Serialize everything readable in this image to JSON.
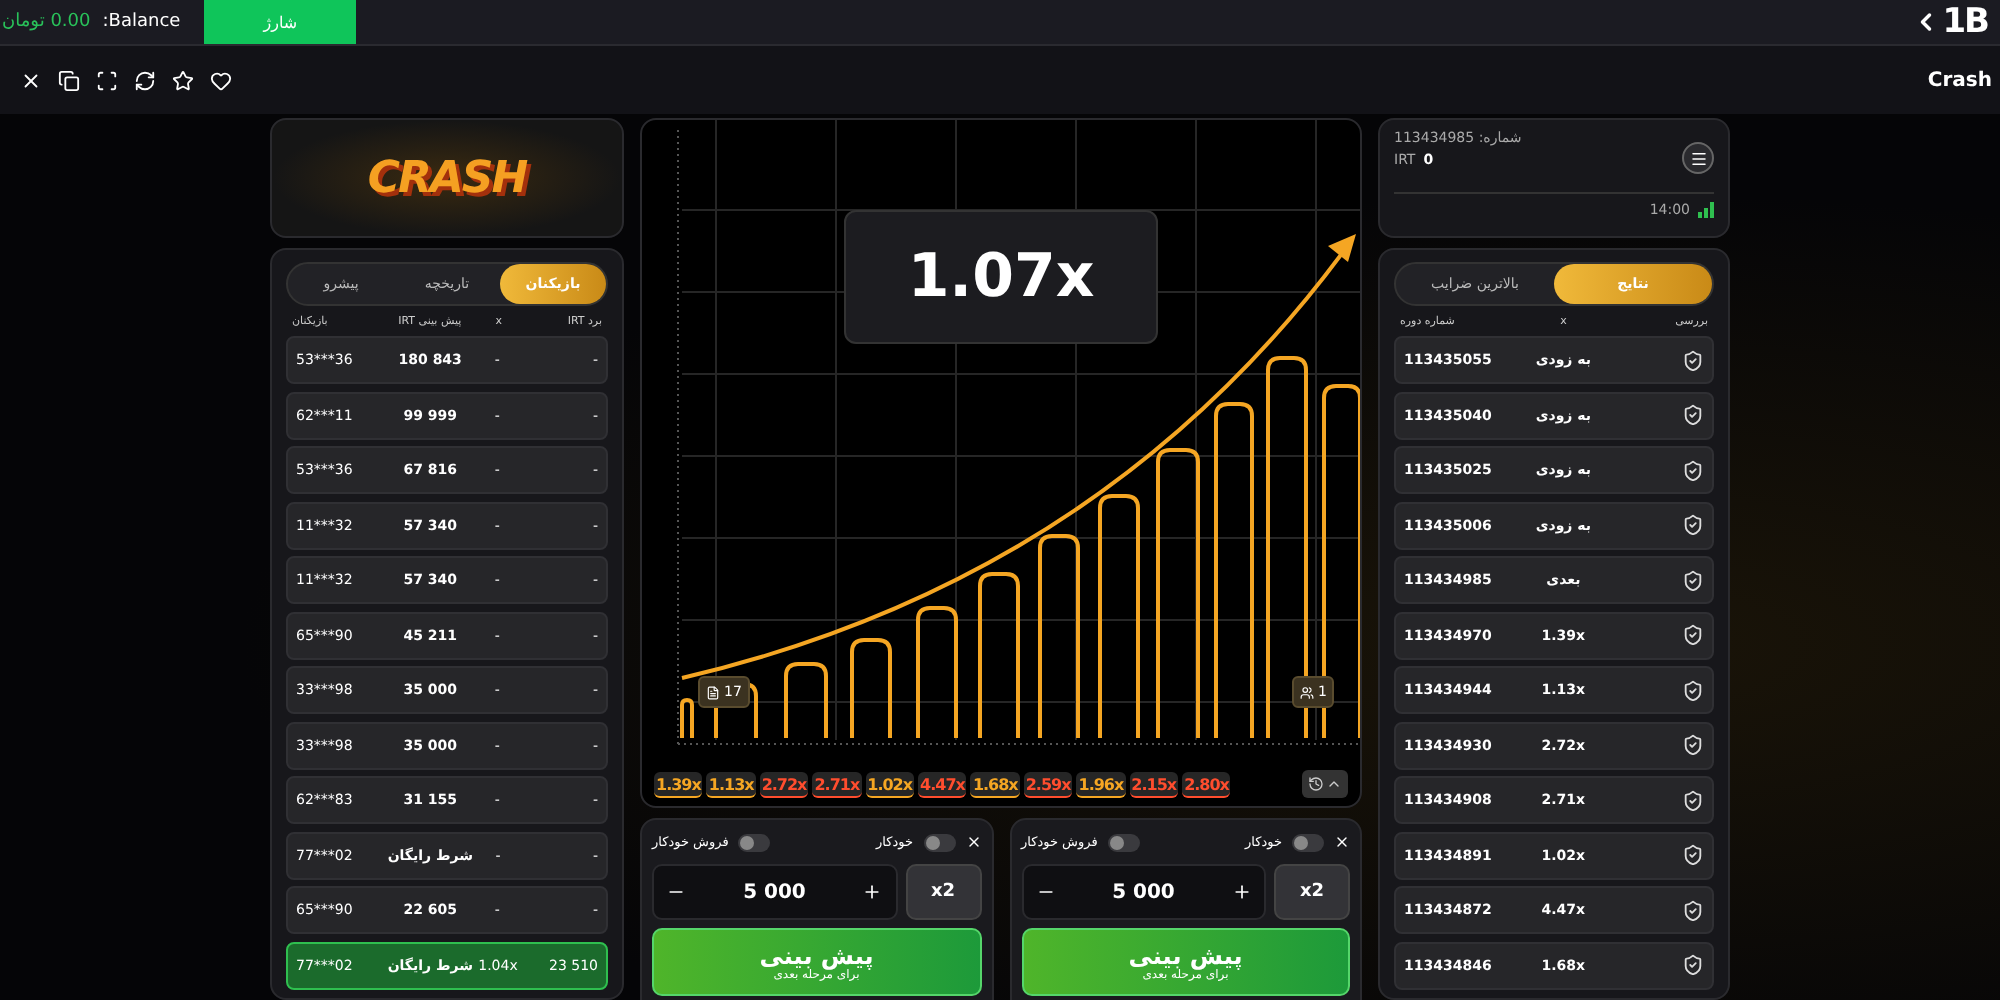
{
  "topbar": {
    "balance_label": "Balance:",
    "balance_value": "0.00 تومان",
    "deposit_button": "شارژ",
    "logo": "1B"
  },
  "toolbar": {
    "title": "Crash"
  },
  "game_logo": "CRASH",
  "players_panel": {
    "tabs": [
      {
        "label": "بازیکنان",
        "selected": true
      },
      {
        "label": "تاریخچه",
        "selected": false
      },
      {
        "label": "پیشرو",
        "selected": false
      }
    ],
    "columns": [
      "برد IRT",
      "x",
      "پیش بینی IRT",
      "بازیکنان"
    ],
    "rows": [
      {
        "player": "53***36",
        "bet": "180 843",
        "multiplier": "-",
        "win": "-",
        "won": false
      },
      {
        "player": "62***11",
        "bet": "99 999",
        "multiplier": "-",
        "win": "-",
        "won": false
      },
      {
        "player": "53***36",
        "bet": "67 816",
        "multiplier": "-",
        "win": "-",
        "won": false
      },
      {
        "player": "11***32",
        "bet": "57 340",
        "multiplier": "-",
        "win": "-",
        "won": false
      },
      {
        "player": "11***32",
        "bet": "57 340",
        "multiplier": "-",
        "win": "-",
        "won": false
      },
      {
        "player": "65***90",
        "bet": "45 211",
        "multiplier": "-",
        "win": "-",
        "won": false
      },
      {
        "player": "33***98",
        "bet": "35 000",
        "multiplier": "-",
        "win": "-",
        "won": false
      },
      {
        "player": "33***98",
        "bet": "35 000",
        "multiplier": "-",
        "win": "-",
        "won": false
      },
      {
        "player": "62***83",
        "bet": "31 155",
        "multiplier": "-",
        "win": "-",
        "won": false
      },
      {
        "player": "77***02",
        "bet": "شرط رایگان",
        "multiplier": "-",
        "win": "-",
        "won": false
      },
      {
        "player": "65***90",
        "bet": "22 605",
        "multiplier": "-",
        "win": "-",
        "won": false
      },
      {
        "player": "77***02",
        "bet": "شرط رایگان",
        "multiplier": "1.04x",
        "win": "23 510",
        "won": true
      }
    ]
  },
  "game": {
    "multiplier": "1.07x",
    "left_badge": "17",
    "right_badge": "1",
    "history": [
      {
        "value": "2.80x",
        "color": "#ff4d2e"
      },
      {
        "value": "2.15x",
        "color": "#ff4d2e"
      },
      {
        "value": "1.96x",
        "color": "#f5a623"
      },
      {
        "value": "2.59x",
        "color": "#ff4d2e"
      },
      {
        "value": "1.68x",
        "color": "#f5a623"
      },
      {
        "value": "4.47x",
        "color": "#ff4d2e"
      },
      {
        "value": "1.02x",
        "color": "#f5a623"
      },
      {
        "value": "2.71x",
        "color": "#ff4d2e"
      },
      {
        "value": "2.72x",
        "color": "#ff4d2e"
      },
      {
        "value": "1.13x",
        "color": "#f5a623"
      },
      {
        "value": "1.39x",
        "color": "#f5a623"
      }
    ]
  },
  "bets": [
    {
      "auto_cashout_label": "فروش خودکار",
      "auto_cashout_on": false,
      "auto_label": "خودکار",
      "auto_on": false,
      "amount": "5 000",
      "double_button": "x2",
      "action_title": "پیش بینی",
      "action_subtitle": "برای مرحله بعدی"
    },
    {
      "auto_cashout_label": "فروش خودکار",
      "auto_cashout_on": false,
      "auto_label": "خودکار",
      "auto_on": false,
      "amount": "5 000",
      "double_button": "x2",
      "action_title": "پیش بینی",
      "action_subtitle": "برای مرحله بعدی"
    }
  ],
  "account": {
    "round_label": "شماره: 113434985",
    "currency": "IRT",
    "balance": "0",
    "time": "14:00"
  },
  "results_panel": {
    "tabs": [
      {
        "label": "نتایج",
        "selected": true
      },
      {
        "label": "بالاترین ضرایب",
        "selected": false
      }
    ],
    "columns": [
      "بررسی",
      "x",
      "شماره دوره"
    ],
    "rows": [
      {
        "round": "113435055",
        "result": "به زودی"
      },
      {
        "round": "113435040",
        "result": "به زودی"
      },
      {
        "round": "113435025",
        "result": "به زودی"
      },
      {
        "round": "113435006",
        "result": "به زودی"
      },
      {
        "round": "113434985",
        "result": "بعدی"
      },
      {
        "round": "113434970",
        "result": "1.39x"
      },
      {
        "round": "113434944",
        "result": "1.13x"
      },
      {
        "round": "113434930",
        "result": "2.72x"
      },
      {
        "round": "113434908",
        "result": "2.71x"
      },
      {
        "round": "113434891",
        "result": "1.02x"
      },
      {
        "round": "113434872",
        "result": "4.47x"
      },
      {
        "round": "113434846",
        "result": "1.68x"
      }
    ]
  }
}
